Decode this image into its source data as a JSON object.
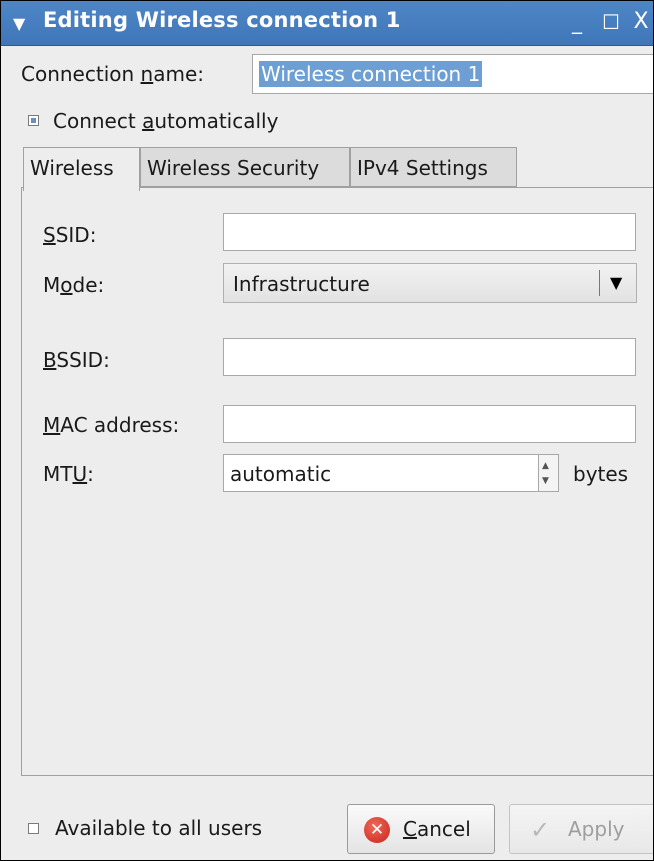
{
  "window": {
    "title": "Editing Wireless connection 1",
    "title_arrow_icon": "menu-arrow-icon",
    "minimize_glyph": "_",
    "maximize_glyph": "☐",
    "close_glyph": "X"
  },
  "connection": {
    "name_label_pre": "Connection ",
    "name_label_u": "n",
    "name_label_post": "ame:",
    "name_value": "Wireless connection 1",
    "auto_connect_checked": true,
    "auto_label_pre": "Connect ",
    "auto_label_u": "a",
    "auto_label_post": "utomatically"
  },
  "tabs": [
    {
      "label": "Wireless",
      "active": true
    },
    {
      "label": "Wireless Security",
      "active": false
    },
    {
      "label": "IPv4 Settings",
      "active": false
    }
  ],
  "wireless": {
    "ssid_label_u": "S",
    "ssid_label_post": "SID:",
    "ssid_value": "",
    "mode_label_pre": "M",
    "mode_label_u": "o",
    "mode_label_post": "de:",
    "mode_value": "Infrastructure",
    "bssid_label_u": "B",
    "bssid_label_post": "SSID:",
    "bssid_value": "",
    "mac_label_u": "M",
    "mac_label_post": "AC address:",
    "mac_value": "",
    "mtu_label_pre": "MT",
    "mtu_label_u": "U",
    "mtu_label_post": ":",
    "mtu_value": "automatic",
    "mtu_unit": "bytes"
  },
  "footer": {
    "all_users_checked": false,
    "all_users_label": "Available to all users",
    "cancel_label_u": "C",
    "cancel_label_post": "ancel",
    "apply_label": "Apply"
  }
}
